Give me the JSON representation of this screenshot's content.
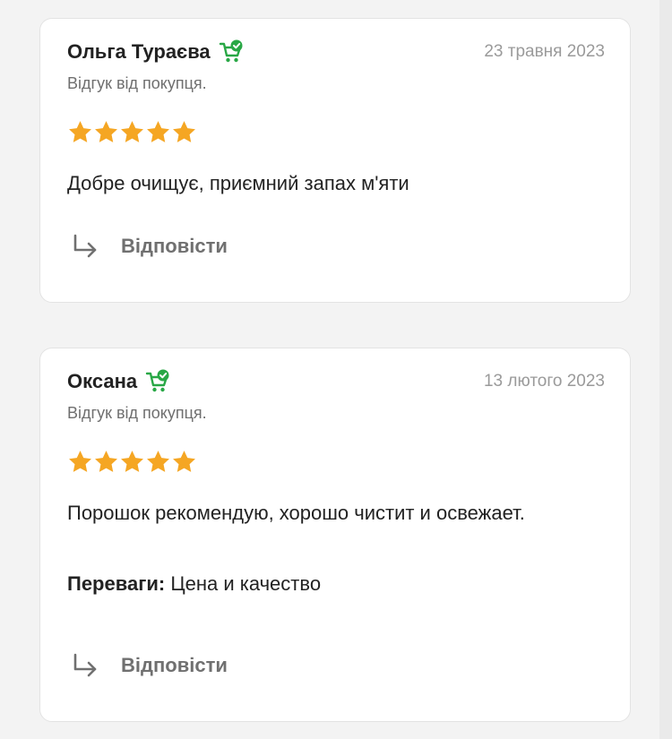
{
  "colors": {
    "accent_green": "#28a745",
    "star": "#f5a623",
    "muted": "#9a9a9a"
  },
  "reviews": [
    {
      "author": "Ольга Тураєва",
      "date": "23 травня 2023",
      "subtitle": "Відгук від покупця.",
      "rating": 5,
      "text": "Добре очищує, приємний запах м'яти",
      "reply_label": "Відповісти",
      "badge_icon": "verified-buyer-cart-icon"
    },
    {
      "author": "Оксана",
      "date": "13 лютого 2023",
      "subtitle": "Відгук від покупця.",
      "rating": 5,
      "text": "Порошок рекомендую, хорошо чистит и освежает.",
      "pros_label": "Переваги:",
      "pros_value": " Цена и качество",
      "reply_label": "Відповісти",
      "badge_icon": "verified-buyer-cart-icon"
    }
  ]
}
